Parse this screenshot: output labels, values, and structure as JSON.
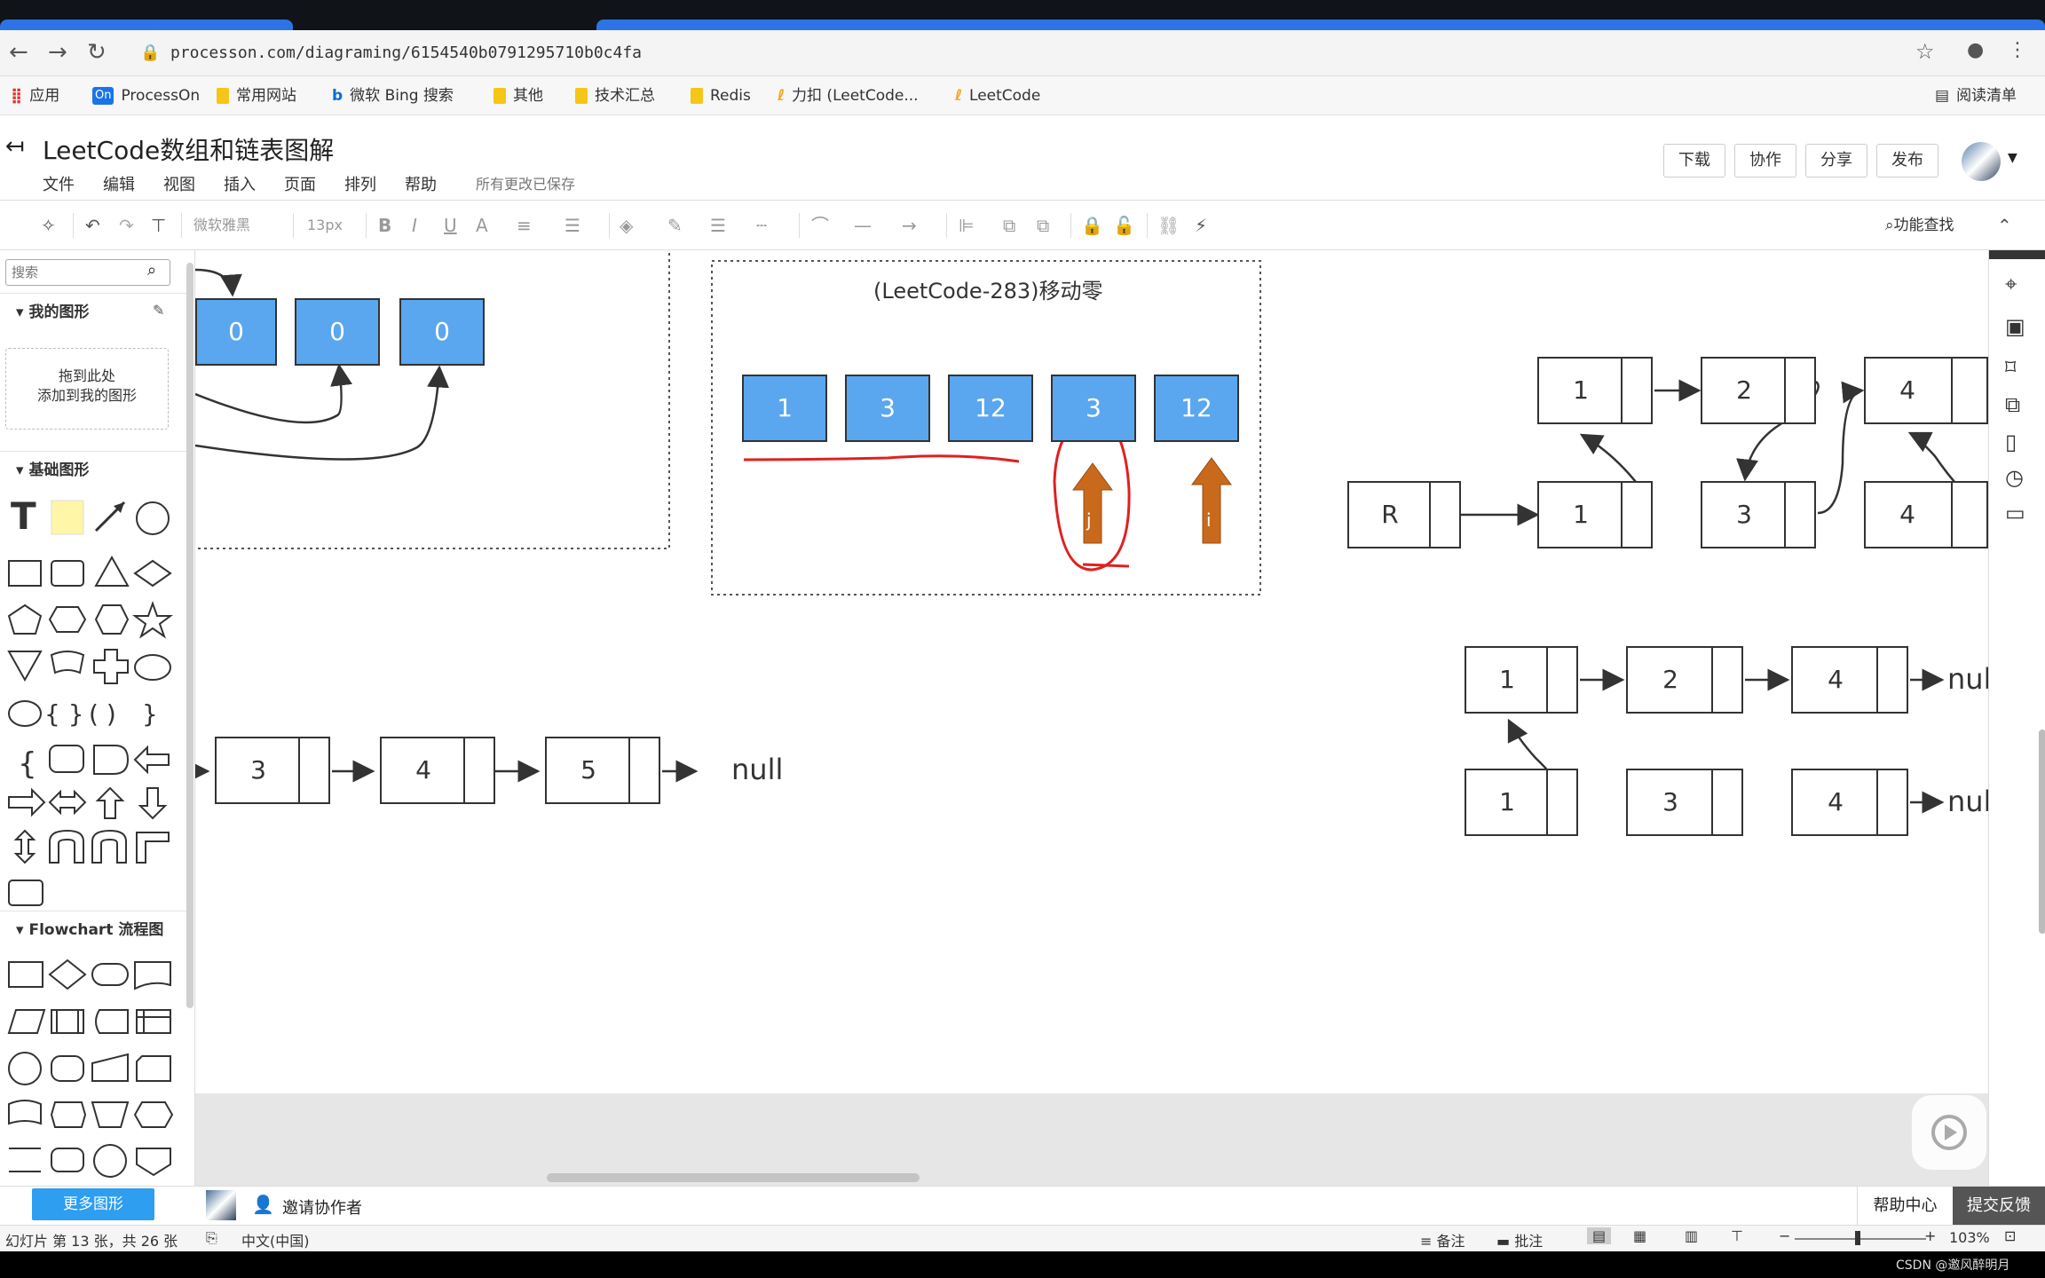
{
  "browser": {
    "url": "processon.com/diagraming/6154540b0791295710b0c4fa",
    "bookmarks": [
      "应用",
      "ProcessOn",
      "常用网站",
      "微软 Bing 搜索",
      "其他",
      "技术汇总",
      "Redis",
      "力扣 (LeetCode...",
      "LeetCode"
    ],
    "reading_list": "阅读清单",
    "processon_badge": "On"
  },
  "app": {
    "title": "LeetCode数组和链表图解",
    "menus": [
      "文件",
      "编辑",
      "视图",
      "插入",
      "页面",
      "排列",
      "帮助"
    ],
    "save_status": "所有更改已保存",
    "buttons": {
      "download": "下载",
      "collab": "协作",
      "share": "分享",
      "publish": "发布"
    }
  },
  "toolbar": {
    "font": "微软雅黑",
    "font_size": "13px",
    "bold": "B",
    "italic": "I",
    "underline": "U",
    "color": "A",
    "feature_search": "功能查找"
  },
  "sidebar": {
    "search_placeholder": "搜索",
    "my_shapes": "我的图形",
    "drop_hint_1": "拖到此处",
    "drop_hint_2": "添加到我的图形",
    "basic_shapes": "基础图形",
    "flowchart": "Flowchart 流程图",
    "more_shapes": "更多图形"
  },
  "canvas": {
    "topleft_zeros": [
      "0",
      "0",
      "0"
    ],
    "box_title": "(LeetCode-283)移动零",
    "move_zero_values": [
      "1",
      "3",
      "12",
      "3",
      "12"
    ],
    "pointer_j": "j",
    "pointer_i": "i",
    "list_left": [
      "3",
      "4",
      "5"
    ],
    "null": "null",
    "right_top_row": [
      "1",
      "2",
      "4"
    ],
    "right_mid_row": [
      "R",
      "1",
      "3",
      "4"
    ],
    "merged_row1": [
      "1",
      "2",
      "4"
    ],
    "merged_row2": [
      "1",
      "3",
      "4"
    ]
  },
  "bottom": {
    "invite": "邀请协作者",
    "help": "帮助中心",
    "feedback": "提交反馈"
  },
  "status": {
    "slide": "幻灯片 第 13 张，共 26 张",
    "lang": "中文(中国)",
    "notes": "备注",
    "comments": "批注",
    "zoom": "103%",
    "watermark": "CSDN @邀风醉明月"
  },
  "colors": {
    "accent": "#5aa7ef",
    "pointer": "#c8691c",
    "redmark": "#e02020",
    "tabblue": "#2d73e6"
  }
}
